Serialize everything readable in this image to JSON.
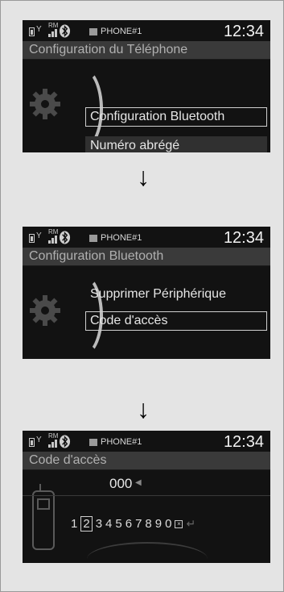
{
  "status": {
    "rm": "RM",
    "phone": "PHONE#1",
    "time": "12:34"
  },
  "screen1": {
    "title": "Configuration du Téléphone",
    "items": [
      "Configuration Bluetooth",
      "Numéro abrégé"
    ]
  },
  "screen2": {
    "title": "Configuration Bluetooth",
    "items": [
      "Supprimer Périphérique",
      "Code d'accès"
    ]
  },
  "screen3": {
    "title": "Code d'accès",
    "code": "000",
    "digits": [
      "1",
      "2",
      "3",
      "4",
      "5",
      "6",
      "7",
      "8",
      "9",
      "0"
    ]
  },
  "arrow": "↓",
  "colors": {
    "screen_bg": "#121212",
    "title_bar": "#3a3a3a",
    "text": "#e6e6e6"
  }
}
